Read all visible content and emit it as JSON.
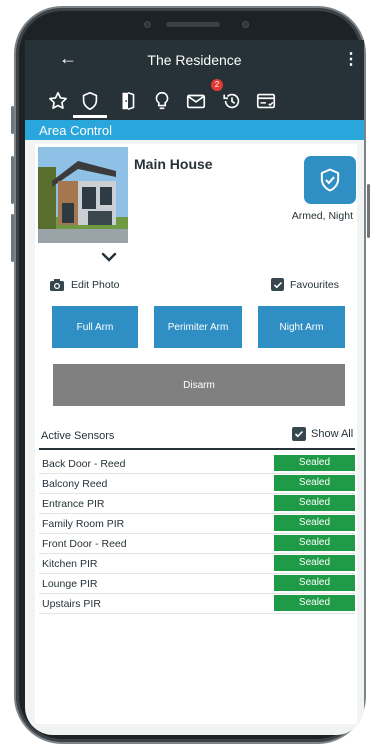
{
  "app": {
    "title": "The Residence",
    "back_icon": "arrow-left-icon",
    "menu_icon": "more-vertical-icon"
  },
  "tabs": [
    {
      "icon": "star-icon",
      "active": false
    },
    {
      "icon": "shield-icon",
      "active": true
    },
    {
      "icon": "door-icon",
      "active": false
    },
    {
      "icon": "lightbulb-icon",
      "active": false
    },
    {
      "icon": "mail-icon",
      "active": false,
      "badge": "2"
    },
    {
      "icon": "history-icon",
      "active": false
    },
    {
      "icon": "card-icon",
      "active": false
    }
  ],
  "section": {
    "title": "Area Control"
  },
  "area": {
    "name": "Main House",
    "status": "Armed, Night",
    "status_icon": "shield-check-icon",
    "edit_photo_label": "Edit Photo",
    "favourites_label": "Favourites",
    "favourites_checked": true
  },
  "actions": {
    "full_arm": "Full Arm",
    "perimeter_arm": "Perimiter Arm",
    "night_arm": "Night Arm",
    "disarm": "Disarm"
  },
  "sensors": {
    "heading": "Active Sensors",
    "show_all_label": "Show All",
    "show_all_checked": true,
    "items": [
      {
        "name": "Back Door - Reed",
        "state": "Sealed"
      },
      {
        "name": "Balcony Reed",
        "state": "Sealed"
      },
      {
        "name": "Entrance PIR",
        "state": "Sealed"
      },
      {
        "name": "Family Room PIR",
        "state": "Sealed"
      },
      {
        "name": "Front Door - Reed",
        "state": "Sealed"
      },
      {
        "name": "Kitchen PIR",
        "state": "Sealed"
      },
      {
        "name": "Lounge PIR",
        "state": "Sealed"
      },
      {
        "name": "Upstairs PIR",
        "state": "Sealed"
      }
    ]
  },
  "colors": {
    "app_bar": "#263238",
    "section_bar": "#29a6dc",
    "accent": "#2f8fc4",
    "disarm": "#808080",
    "sealed": "#1f9a46",
    "badge": "#e53935"
  }
}
